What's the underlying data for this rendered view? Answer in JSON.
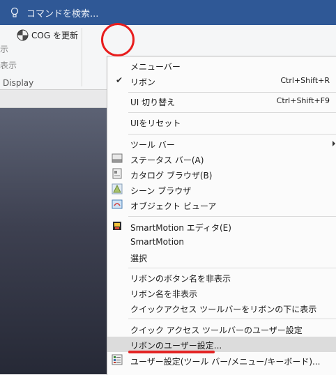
{
  "search": {
    "placeholder": "コマンドを検索..."
  },
  "ribbon": {
    "cog_label": "COG を更新",
    "frag_top": "示",
    "frag_bottom": "表示",
    "panel_label": "Display"
  },
  "menu": {
    "items": [
      {
        "label": "メニューバー"
      },
      {
        "label": "リボン",
        "checked": true,
        "shortcut": "Ctrl+Shift+R"
      },
      {
        "label": "UI 切り替え",
        "shortcut": "Ctrl+Shift+F9"
      },
      {
        "label": "UIをリセット"
      },
      {
        "label": "ツール バー",
        "submenu": true
      },
      {
        "label": "ステータス バー(A)",
        "icon": "status-bar-icon"
      },
      {
        "label": "カタログ ブラウザ(B)",
        "icon": "catalog-browser-icon"
      },
      {
        "label": "シーン ブラウザ",
        "icon": "scene-browser-icon"
      },
      {
        "label": "オブジェクト ビューア",
        "icon": "object-viewer-icon"
      },
      {
        "label": "SmartMotion エディタ(E)",
        "icon": "smartmotion-editor-icon"
      },
      {
        "label": "SmartMotion"
      },
      {
        "label": "選択"
      },
      {
        "label": "リボンのボタン名を非表示"
      },
      {
        "label": "リボン名を非表示"
      },
      {
        "label": "クイックアクセス ツールバーをリボンの下に表示"
      },
      {
        "label": "クイック アクセス ツールバーのユーザー設定"
      },
      {
        "label": "リボンのユーザー設定...",
        "highlighted": true
      },
      {
        "label": "ユーザー設定(ツール バー/メニュー/キーボード)...",
        "icon": "customize-icon"
      }
    ]
  },
  "colors": {
    "topbar": "#2f5896",
    "annotation": "#e81d1d",
    "highlight": "#dcdcdc"
  }
}
